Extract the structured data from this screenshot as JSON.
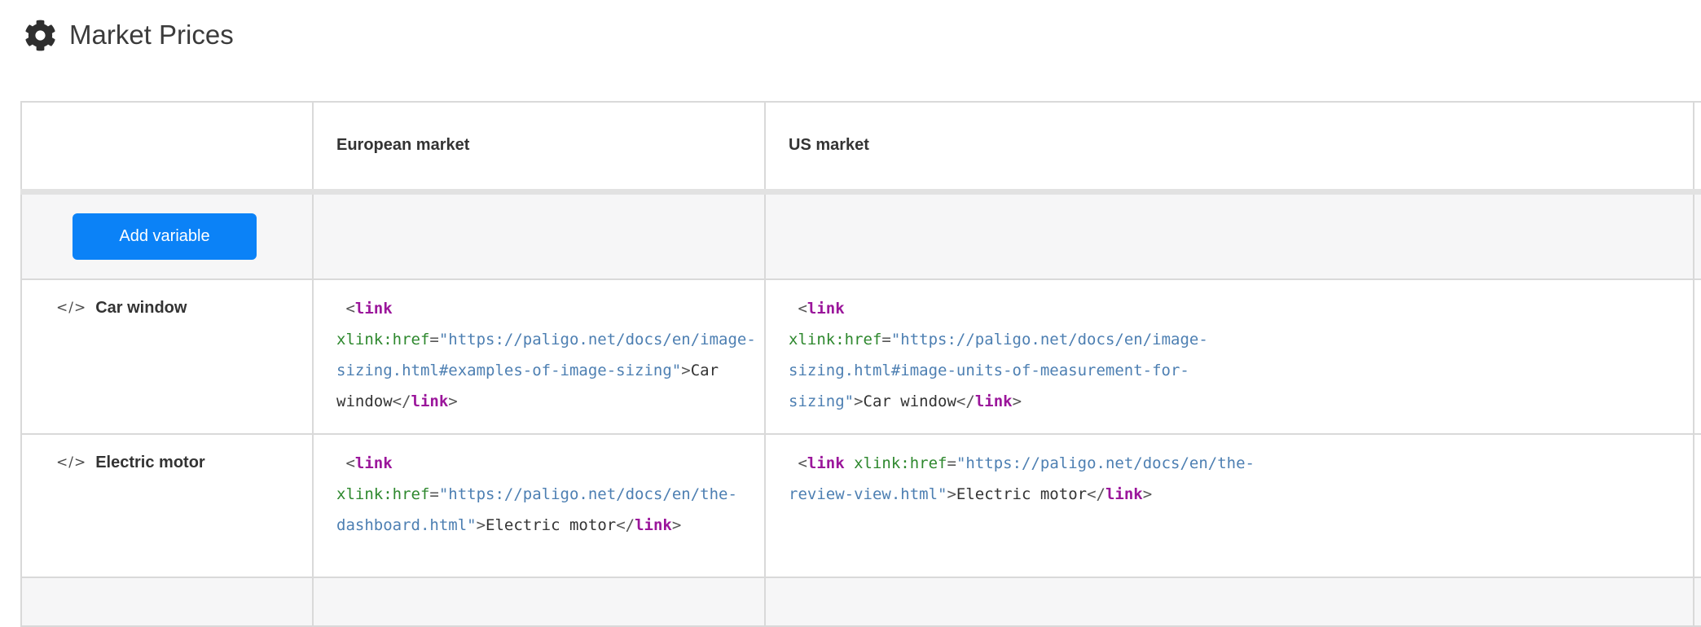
{
  "header": {
    "title": "Market Prices"
  },
  "icons": {
    "code_glyph": "</>"
  },
  "table": {
    "columns": {
      "empty": "",
      "european": "European market",
      "us": "US market"
    },
    "add_button_label": "Add variable",
    "rows": [
      {
        "name": "Car window",
        "european_code": [
          [
            [
              "punct",
              " <"
            ],
            [
              "tag",
              "link"
            ]
          ],
          [
            [
              "attr",
              "xlink:href"
            ],
            [
              "punct",
              "="
            ],
            [
              "string",
              "\"https://paligo.net/docs/en/image-"
            ]
          ],
          [
            [
              "string",
              "sizing.html#examples-of-image-sizing\""
            ],
            [
              "punct",
              ">"
            ],
            [
              "text",
              "Car"
            ]
          ],
          [
            [
              "text",
              "window"
            ],
            [
              "punct",
              "</"
            ],
            [
              "tag",
              "link"
            ],
            [
              "punct",
              ">"
            ]
          ]
        ],
        "us_code": [
          [
            [
              "punct",
              " <"
            ],
            [
              "tag",
              "link"
            ]
          ],
          [
            [
              "attr",
              "xlink:href"
            ],
            [
              "punct",
              "="
            ],
            [
              "string",
              "\"https://paligo.net/docs/en/image-"
            ]
          ],
          [
            [
              "string",
              "sizing.html#image-units-of-measurement-for-"
            ]
          ],
          [
            [
              "string",
              "sizing\""
            ],
            [
              "punct",
              ">"
            ],
            [
              "text",
              "Car window"
            ],
            [
              "punct",
              "</"
            ],
            [
              "tag",
              "link"
            ],
            [
              "punct",
              ">"
            ]
          ]
        ]
      },
      {
        "name": "Electric motor",
        "european_code": [
          [
            [
              "punct",
              " <"
            ],
            [
              "tag",
              "link"
            ]
          ],
          [
            [
              "attr",
              "xlink:href"
            ],
            [
              "punct",
              "="
            ],
            [
              "string",
              "\"https://paligo.net/docs/en/the-"
            ]
          ],
          [
            [
              "string",
              "dashboard.html\""
            ],
            [
              "punct",
              ">"
            ],
            [
              "text",
              "Electric motor"
            ],
            [
              "punct",
              "</"
            ],
            [
              "tag",
              "link"
            ],
            [
              "punct",
              ">"
            ]
          ]
        ],
        "us_code": [
          [
            [
              "punct",
              " <"
            ],
            [
              "tag",
              "link"
            ],
            [
              "punct",
              " "
            ],
            [
              "attr",
              "xlink:href"
            ],
            [
              "punct",
              "="
            ],
            [
              "string",
              "\"https://paligo.net/docs/en/the-"
            ]
          ],
          [
            [
              "string",
              "review-view.html\""
            ],
            [
              "punct",
              ">"
            ],
            [
              "text",
              "Electric motor"
            ],
            [
              "punct",
              "</"
            ],
            [
              "tag",
              "link"
            ],
            [
              "punct",
              ">"
            ]
          ]
        ]
      }
    ]
  },
  "colors": {
    "accent_blue": "#0b82f7",
    "code_tag": "#9b169b",
    "code_attr": "#2e882e",
    "code_string": "#4d7fb2",
    "code_punct": "#555555",
    "code_text": "#333333",
    "border_gray": "#d9d9d9",
    "divider_gray": "#e2e2e2",
    "row_gray": "#f6f6f7"
  }
}
